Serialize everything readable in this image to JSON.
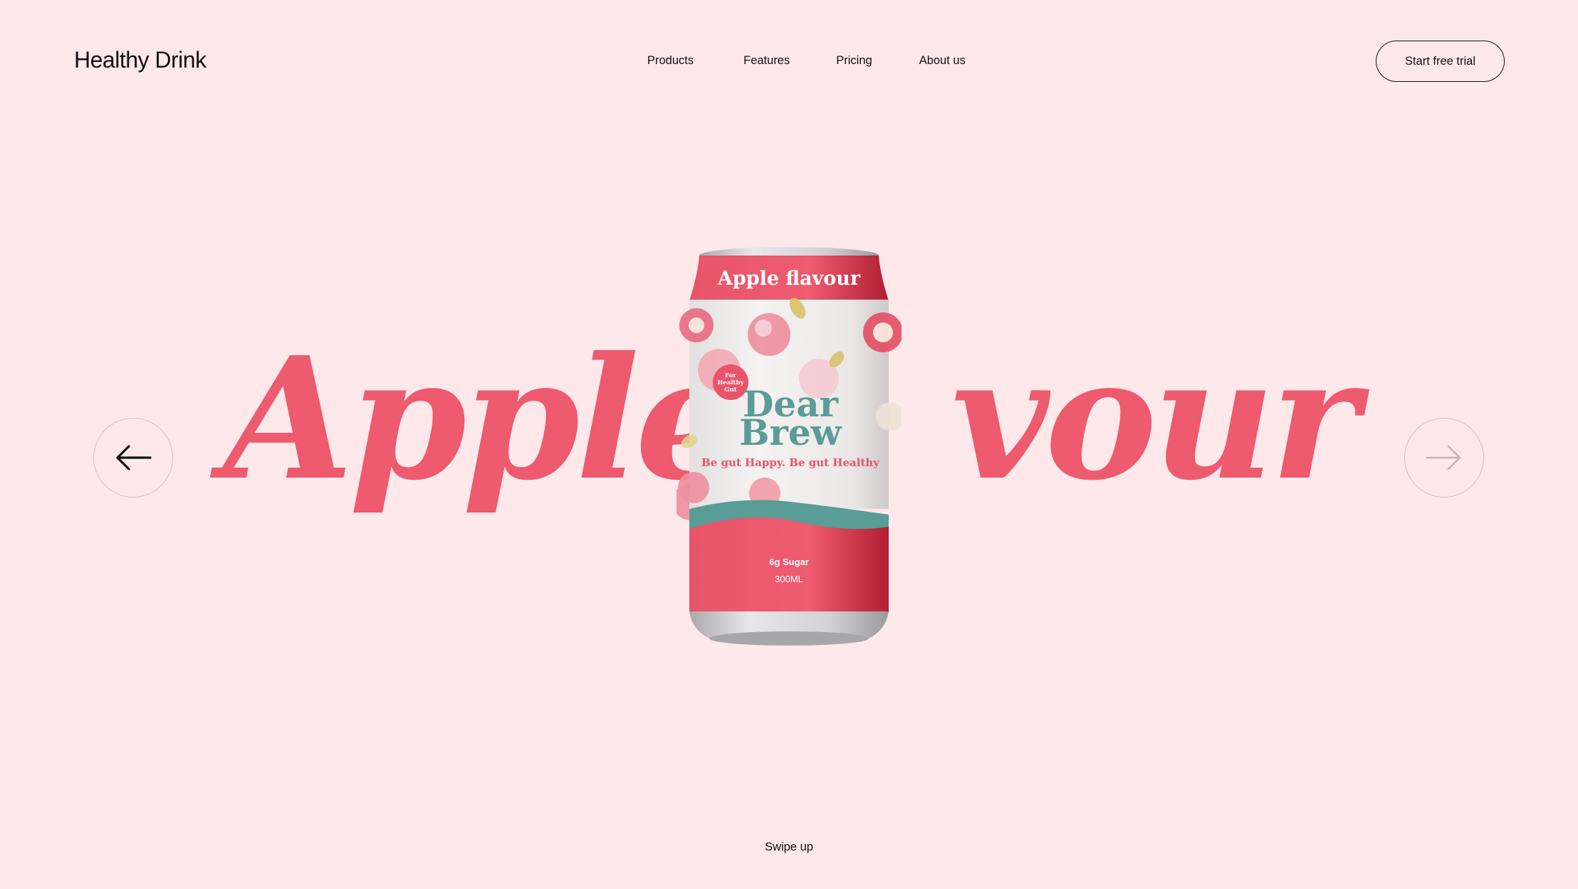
{
  "header": {
    "logo_bold": "Healthy",
    "logo_light": "Drink",
    "nav": [
      "Products",
      "Features",
      "Pricing",
      "About us"
    ],
    "cta_label": "Start free trial"
  },
  "hero": {
    "big_word_left": "Apple",
    "big_word_right": "vour",
    "can": {
      "top_label": "Apple flavour",
      "badge": [
        "For",
        "Healthy",
        "Gut"
      ],
      "brand_line1": "Dear",
      "brand_line2": "Brew",
      "tagline": "Be gut Happy. Be gut Healthy",
      "sugar": "6g Sugar",
      "volume": "300ML"
    }
  },
  "footer": {
    "swipe_label": "Swipe up"
  },
  "colors": {
    "background": "#fee8ea",
    "accent": "#ee5a6e",
    "teal": "#5a9c96"
  },
  "icons": {
    "prev": "arrow-left-icon",
    "next": "arrow-right-icon"
  }
}
